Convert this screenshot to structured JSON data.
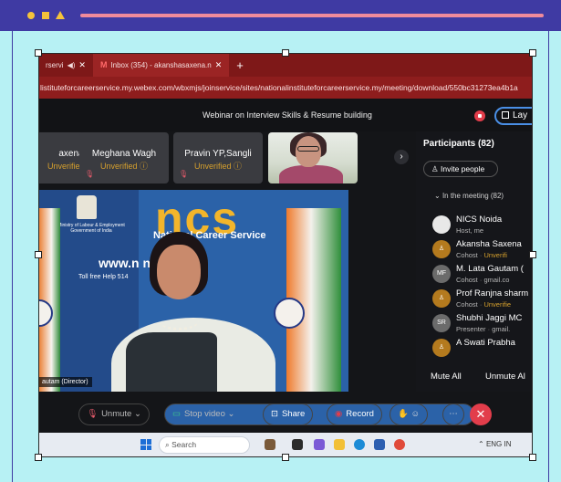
{
  "browser": {
    "tabs": [
      {
        "label": "rservi",
        "active": false
      },
      {
        "label": "Inbox (354) - akanshasaxena.n",
        "active": true
      }
    ],
    "address": "listituteforcareerservice.my.webex.com/wbxmjs/joinservice/sites/nationalinstituteforcareerservice.my/meeting/download/550bc31273ea4b1a"
  },
  "meeting": {
    "title": "Webinar on Interview Skills & Resume building",
    "layout_label": "Lay"
  },
  "thumbnails": [
    {
      "name": "axena",
      "status": "Unverified"
    },
    {
      "name": "Meghana Wagh",
      "status": "Unverified"
    },
    {
      "name": "Pravin YP,Sangli",
      "status": "Unverified"
    }
  ],
  "video": {
    "ministry": "Ministry of Labour & Employment Government of India",
    "ncs_logo": "ncs",
    "ncs_subtitle": "National Career Service",
    "website": "www.n             n",
    "toll_free": "Toll free Help                          514",
    "name_tag": "autam (Director)"
  },
  "participants": {
    "title": "Participants (82)",
    "invite_label": "Invite people",
    "section_label": "In the meeting (82)",
    "list": [
      {
        "avatar": "",
        "name": "NICS Noida",
        "role": "Host, me",
        "extra": ""
      },
      {
        "avatar": "",
        "name": "Akansha Saxena",
        "role": "Cohost",
        "extra": "Unverifi"
      },
      {
        "avatar": "MF",
        "name": "M. Lata Gautam (",
        "role": "Cohost",
        "extra": "gmail.co"
      },
      {
        "avatar": "",
        "name": "Prof Ranjna sharm",
        "role": "Cohost",
        "extra": "Unverifie"
      },
      {
        "avatar": "SR",
        "name": "Shubhi Jaggi MC",
        "role": "Presenter",
        "extra": "gmail."
      },
      {
        "avatar": "",
        "name": "A Swati Prabha",
        "role": "",
        "extra": ""
      }
    ],
    "mute_all": "Mute All",
    "unmute_all": "Unmute Al"
  },
  "controls": {
    "unmute": "Unmute",
    "stop_video": "Stop video",
    "share": "Share",
    "record": "Record"
  },
  "taskbar": {
    "search_placeholder": "Search",
    "tray_text": "ENG IN"
  }
}
